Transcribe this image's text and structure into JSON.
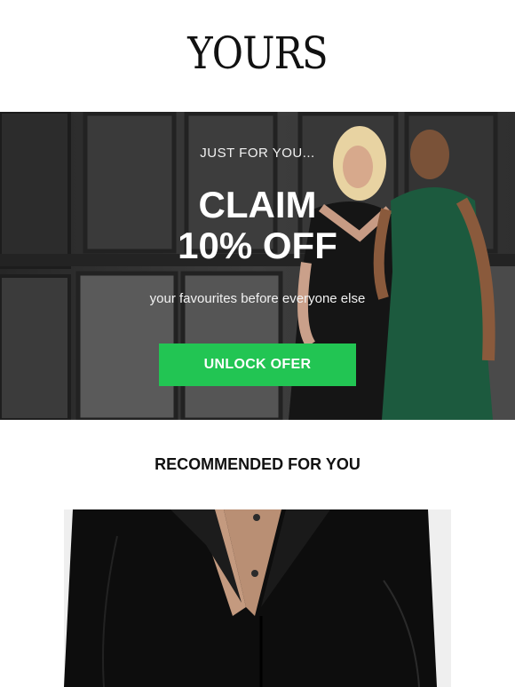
{
  "brand": {
    "logo_text": "YOURS"
  },
  "hero": {
    "eyebrow": "JUST FOR YOU...",
    "headline_line1": "CLAIM",
    "headline_line2": "10% OFF",
    "subline": "your favourites before everyone else",
    "cta_label": "UNLOCK OFER",
    "colors": {
      "cta": "#22c553",
      "door": "#3a3a3a"
    }
  },
  "recommended": {
    "title": "RECOMMENDED FOR YOU",
    "product_color": "black"
  }
}
